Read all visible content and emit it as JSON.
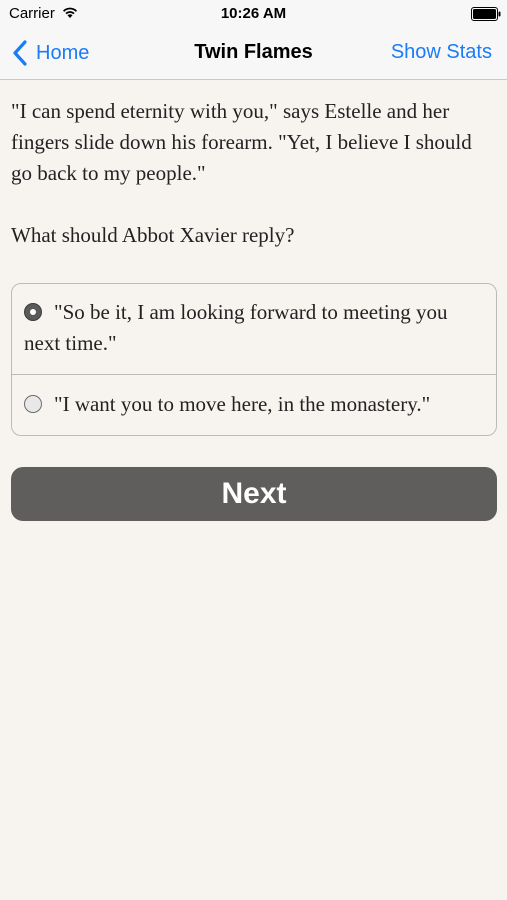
{
  "status_bar": {
    "carrier": "Carrier",
    "time": "10:26 AM"
  },
  "nav": {
    "back_label": "Home",
    "title": "Twin Flames",
    "right_label": "Show Stats",
    "accent_color": "#1a7cf7"
  },
  "story": {
    "text": "\"I can spend eternity with you,\" says Estelle and her fingers slide down his forearm. \"Yet, I believe I should go back to my people.\"",
    "question": "What should Abbot Xavier reply?"
  },
  "choices": [
    {
      "label": "\"So be it, I am looking forward to meeting you next time.\"",
      "selected": true
    },
    {
      "label": "\"I want you to move here, in the monastery.\"",
      "selected": false
    }
  ],
  "next_button": {
    "label": "Next",
    "color": "#5f5e5d"
  }
}
